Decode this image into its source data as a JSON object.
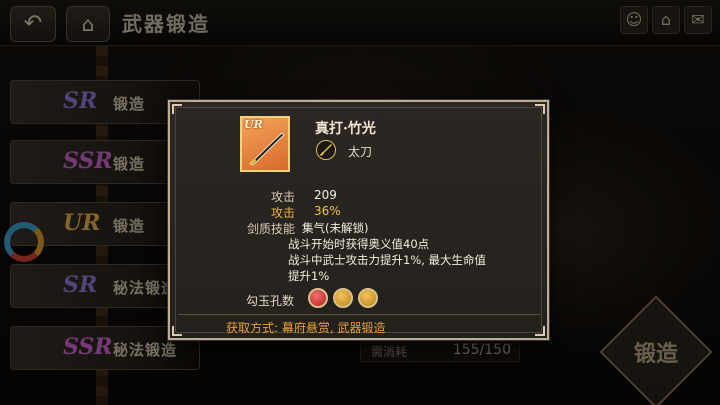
{
  "header": {
    "back_icon": "↶",
    "home_icon": "⌂",
    "title": "武器锻造",
    "icons": [
      {
        "name": "mask-icon",
        "glyph": "☺"
      },
      {
        "name": "home-icon",
        "glyph": "⌂"
      },
      {
        "name": "mail-icon",
        "glyph": "✉"
      }
    ]
  },
  "sidebar": {
    "items": [
      {
        "rank": "SR",
        "label": "锻造"
      },
      {
        "rank": "SSR",
        "label": "锻造"
      },
      {
        "rank": "UR",
        "label": "锻造"
      },
      {
        "rank": "SR",
        "label": "秘法锻造"
      },
      {
        "rank": "SSR",
        "label": "秘法锻造"
      }
    ]
  },
  "footer": {
    "cost_label": "需消耗",
    "cost_value": "155/150",
    "forge_label": "锻造"
  },
  "popup": {
    "item_rank": "UR",
    "item_name": "真打·竹光",
    "item_type": "太刀",
    "stats": [
      {
        "label": "攻击",
        "value": "209",
        "highlight": false
      },
      {
        "label": "攻击",
        "value": "36%",
        "highlight": true
      }
    ],
    "skill_label": "剑质技能",
    "skill_lines": [
      "集气(未解锁)",
      "战斗开始时获得奥义值40点",
      "战斗中武士攻击力提升1%, 最大生命值",
      "提升1%"
    ],
    "jade_label": "勾玉孔数",
    "jade_slots": [
      "red",
      "gold",
      "gold"
    ],
    "source": "获取方式: 幕府悬赏, 武器锻造"
  }
}
